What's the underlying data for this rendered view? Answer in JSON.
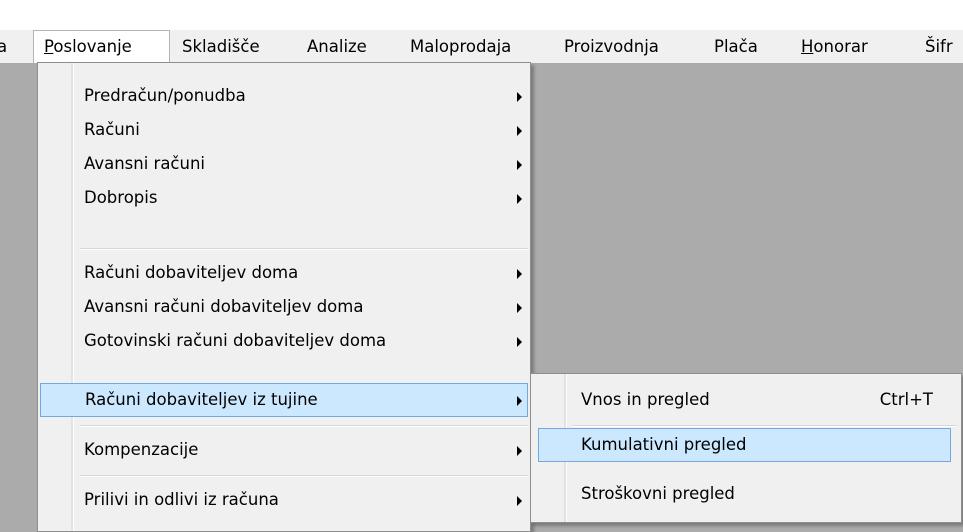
{
  "menubar": {
    "cut_left_item": "a",
    "items": [
      {
        "label": "Poslovanje",
        "mnemonic": "P",
        "rest": "oslovanje",
        "active": true
      },
      {
        "label": "Skladišče"
      },
      {
        "label": "Analize"
      },
      {
        "label": "Maloprodaja"
      },
      {
        "label": "Proizvodnja"
      },
      {
        "label": "Plača"
      },
      {
        "label": "Honorar",
        "mnemonic": "H",
        "rest": "onorar"
      },
      {
        "label": "Šifr"
      }
    ]
  },
  "poslovanje_menu": {
    "items": [
      {
        "label": "Predračun/ponudba"
      },
      {
        "label": "Računi"
      },
      {
        "label": "Avansni računi"
      },
      {
        "label": "Dobropis"
      },
      {
        "label": "Računi dobaviteljev doma"
      },
      {
        "label": "Avansni računi dobaviteljev doma"
      },
      {
        "label": "Gotovinski računi dobaviteljev doma"
      },
      {
        "label": "Računi dobaviteljev iz tujine",
        "highlighted": true
      },
      {
        "label": "Kompenzacije"
      },
      {
        "label": "Prilivi in odlivi iz računa"
      }
    ]
  },
  "submenu": {
    "items": [
      {
        "label": "Vnos in pregled",
        "shortcut": "Ctrl+T"
      },
      {
        "label": "Kumulativni pregled",
        "highlighted": true
      },
      {
        "label": "Stroškovni pregled"
      }
    ]
  },
  "colors": {
    "highlight_bg": "#cce8ff",
    "highlight_border": "#75a8de",
    "workspace_bg": "#ababab",
    "menu_bg": "#f0f0f0"
  },
  "icons": {
    "submenu_arrow": "triangle-right"
  }
}
